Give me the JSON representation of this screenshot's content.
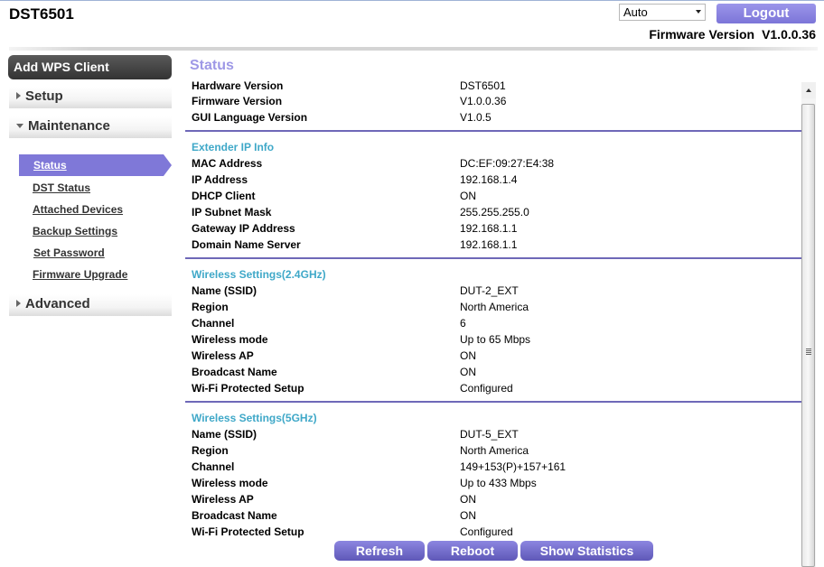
{
  "header": {
    "model": "DST6501",
    "language_select": {
      "value": "Auto"
    },
    "logout_label": "Logout",
    "firmware_label": "Firmware Version",
    "firmware_value": "V1.0.0.36"
  },
  "sidebar": {
    "wps_button": "Add WPS Client",
    "setup": "Setup",
    "maintenance": "Maintenance",
    "maintenance_items": [
      "Status",
      "DST Status",
      "Attached Devices",
      "Backup Settings",
      "Set Password",
      "Firmware Upgrade"
    ],
    "advanced": "Advanced"
  },
  "main": {
    "title": "Status",
    "router_info": [
      {
        "label": "Hardware Version",
        "value": "DST6501"
      },
      {
        "label": "Firmware Version",
        "value": "V1.0.0.36"
      },
      {
        "label": "GUI Language Version",
        "value": "V1.0.5"
      }
    ],
    "ip_info": {
      "title": "Extender IP Info",
      "rows": [
        {
          "label": "MAC Address",
          "value": "DC:EF:09:27:E4:38"
        },
        {
          "label": "IP Address",
          "value": "192.168.1.4"
        },
        {
          "label": "DHCP Client",
          "value": "ON"
        },
        {
          "label": "IP Subnet Mask",
          "value": "255.255.255.0"
        },
        {
          "label": "Gateway IP Address",
          "value": "192.168.1.1"
        },
        {
          "label": "Domain Name Server",
          "value": "192.168.1.1"
        }
      ]
    },
    "wifi24": {
      "title": "Wireless Settings(2.4GHz)",
      "rows": [
        {
          "label": "Name (SSID)",
          "value": "DUT-2_EXT"
        },
        {
          "label": "Region",
          "value": "North America"
        },
        {
          "label": "Channel",
          "value": "6"
        },
        {
          "label": "Wireless mode",
          "value": "Up to 65 Mbps"
        },
        {
          "label": "Wireless AP",
          "value": "ON"
        },
        {
          "label": "Broadcast Name",
          "value": "ON"
        },
        {
          "label": "Wi-Fi Protected Setup",
          "value": "Configured"
        }
      ]
    },
    "wifi5": {
      "title": "Wireless Settings(5GHz)",
      "rows": [
        {
          "label": "Name (SSID)",
          "value": "DUT-5_EXT"
        },
        {
          "label": "Region",
          "value": "North America"
        },
        {
          "label": "Channel",
          "value": "149+153(P)+157+161"
        },
        {
          "label": "Wireless mode",
          "value": "Up to 433 Mbps"
        },
        {
          "label": "Wireless AP",
          "value": "ON"
        },
        {
          "label": "Broadcast Name",
          "value": "ON"
        },
        {
          "label": "Wi-Fi Protected Setup",
          "value": "Configured"
        }
      ]
    },
    "buttons": {
      "refresh": "Refresh",
      "reboot": "Reboot",
      "statistics": "Show Statistics"
    }
  }
}
